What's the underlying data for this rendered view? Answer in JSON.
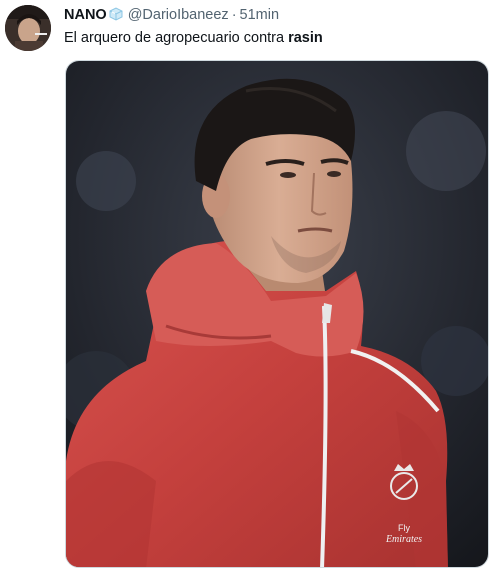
{
  "tweet": {
    "display_name": "NANO",
    "name_emoji_icon": "ice-cube-icon",
    "handle": "@DarioIbaneez",
    "separator": "·",
    "time": "51min",
    "text_before": "El arquero de agropecuario contra ",
    "text_bold": "rasin",
    "media": {
      "crest_text_1": "Fly",
      "crest_text_2": "Emirates"
    }
  }
}
